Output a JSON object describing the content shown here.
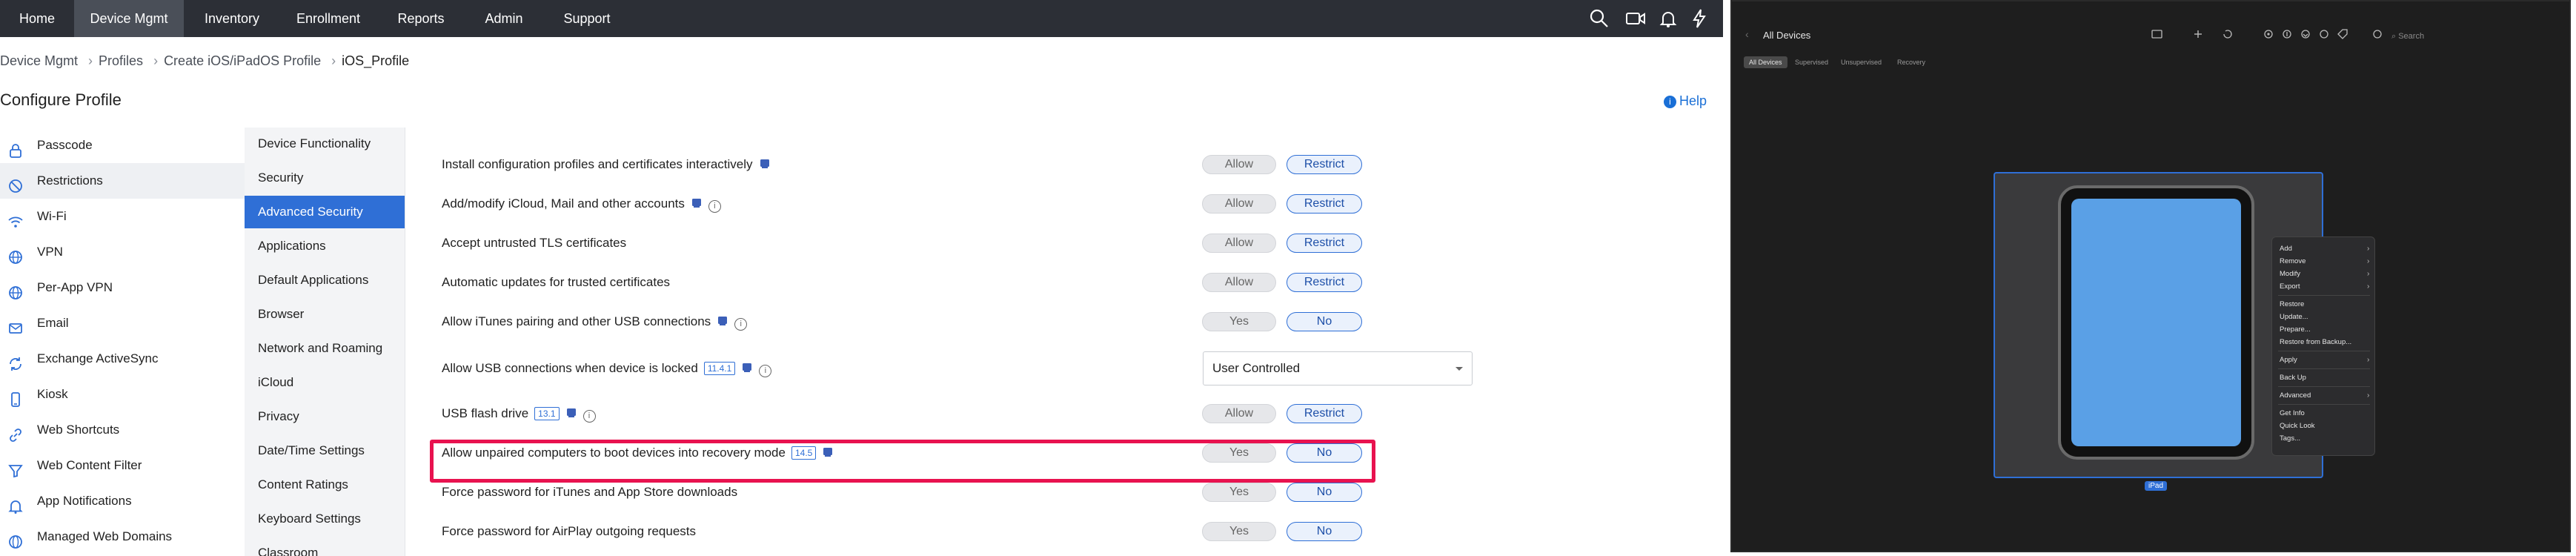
{
  "nav": {
    "items": [
      "Home",
      "Device Mgmt",
      "Inventory",
      "Enrollment",
      "Reports",
      "Admin",
      "Support"
    ],
    "active": "Device Mgmt",
    "icons": [
      "search-icon",
      "video-icon",
      "bell-icon",
      "bolt-icon"
    ]
  },
  "breadcrumb": [
    "Device Mgmt",
    "Profiles",
    "Create iOS/iPadOS Profile",
    "iOS_Profile"
  ],
  "page": {
    "title": "Configure Profile",
    "help": "Help"
  },
  "sidebar": {
    "items": [
      {
        "label": "Passcode",
        "icon": "lock-icon"
      },
      {
        "label": "Restrictions",
        "icon": "restriction-icon"
      },
      {
        "label": "Wi-Fi",
        "icon": "wifi-icon"
      },
      {
        "label": "VPN",
        "icon": "globe-icon"
      },
      {
        "label": "Per-App VPN",
        "icon": "globe-icon"
      },
      {
        "label": "Email",
        "icon": "envelope-icon"
      },
      {
        "label": "Exchange ActiveSync",
        "icon": "sync-icon"
      },
      {
        "label": "Kiosk",
        "icon": "kiosk-icon"
      },
      {
        "label": "Web Shortcuts",
        "icon": "link-icon"
      },
      {
        "label": "Web Content Filter",
        "icon": "filter-icon"
      },
      {
        "label": "App Notifications",
        "icon": "bell-icon"
      },
      {
        "label": "Managed Web Domains",
        "icon": "domain-icon"
      }
    ],
    "active": "Restrictions"
  },
  "subnav": {
    "items": [
      "Device Functionality",
      "Security",
      "Advanced Security",
      "Applications",
      "Default Applications",
      "Browser",
      "Network and Roaming",
      "iCloud",
      "Privacy",
      "Date/Time Settings",
      "Content Ratings",
      "Keyboard Settings",
      "Classroom"
    ],
    "active": "Advanced Security"
  },
  "settings": [
    {
      "label": "Install configuration profiles and certificates interactively",
      "badge": "",
      "dev": true,
      "info": false,
      "opt1": "Allow",
      "opt2": "Restrict",
      "selected": 2
    },
    {
      "label": "Add/modify iCloud, Mail and other accounts",
      "badge": "",
      "dev": true,
      "info": true,
      "opt1": "Allow",
      "opt2": "Restrict",
      "selected": 2
    },
    {
      "label": "Accept untrusted TLS certificates",
      "badge": "",
      "dev": false,
      "info": false,
      "opt1": "Allow",
      "opt2": "Restrict",
      "selected": 2
    },
    {
      "label": "Automatic updates for trusted certificates",
      "badge": "",
      "dev": false,
      "info": false,
      "opt1": "Allow",
      "opt2": "Restrict",
      "selected": 2
    },
    {
      "label": "Allow iTunes pairing and other USB connections",
      "badge": "",
      "dev": true,
      "info": true,
      "opt1": "Yes",
      "opt2": "No",
      "selected": 2
    },
    {
      "label": "Allow USB connections when device is locked",
      "badge": "11.4.1",
      "dev": true,
      "info": true,
      "select": "User Controlled"
    },
    {
      "label": "USB flash drive",
      "badge": "13.1",
      "dev": true,
      "info": true,
      "opt1": "Allow",
      "opt2": "Restrict",
      "selected": 2
    },
    {
      "label": "Allow unpaired computers to boot devices into recovery mode",
      "badge": "14.5",
      "dev": true,
      "info": false,
      "opt1": "Yes",
      "opt2": "No",
      "selected": 2
    },
    {
      "label": "Force password for iTunes and App Store downloads",
      "badge": "",
      "dev": false,
      "info": false,
      "opt1": "Yes",
      "opt2": "No",
      "selected": 2
    },
    {
      "label": "Force password for AirPlay outgoing requests",
      "badge": "",
      "dev": false,
      "info": false,
      "opt1": "Yes",
      "opt2": "No",
      "selected": 2
    }
  ],
  "mac": {
    "title": "All Devices",
    "search_placeholder": "Search",
    "tabs": [
      "All Devices",
      "Supervised",
      "Unsupervised",
      "Recovery"
    ],
    "active_tab": "All Devices",
    "device_label": "iPad",
    "context_menu": [
      {
        "label": "Add",
        "submenu": true
      },
      {
        "label": "Remove",
        "submenu": true
      },
      {
        "label": "Modify",
        "submenu": true
      },
      {
        "label": "Export",
        "submenu": true
      },
      {
        "label": "Restore",
        "submenu": false
      },
      {
        "label": "Update...",
        "submenu": false
      },
      {
        "label": "Prepare...",
        "submenu": false
      },
      {
        "label": "Restore from Backup...",
        "submenu": false
      },
      {
        "label": "Apply",
        "submenu": true
      },
      {
        "label": "Back Up",
        "submenu": false
      },
      {
        "label": "Advanced",
        "submenu": true
      },
      {
        "label": "Get Info",
        "submenu": false
      },
      {
        "label": "Quick Look",
        "submenu": false
      },
      {
        "label": "Tags...",
        "submenu": false
      }
    ]
  },
  "colors": {
    "nav_bg": "#2c2f36",
    "accent": "#2f6fd6",
    "highlight": "#e8124f",
    "mac_bg": "#1e1e1e"
  }
}
